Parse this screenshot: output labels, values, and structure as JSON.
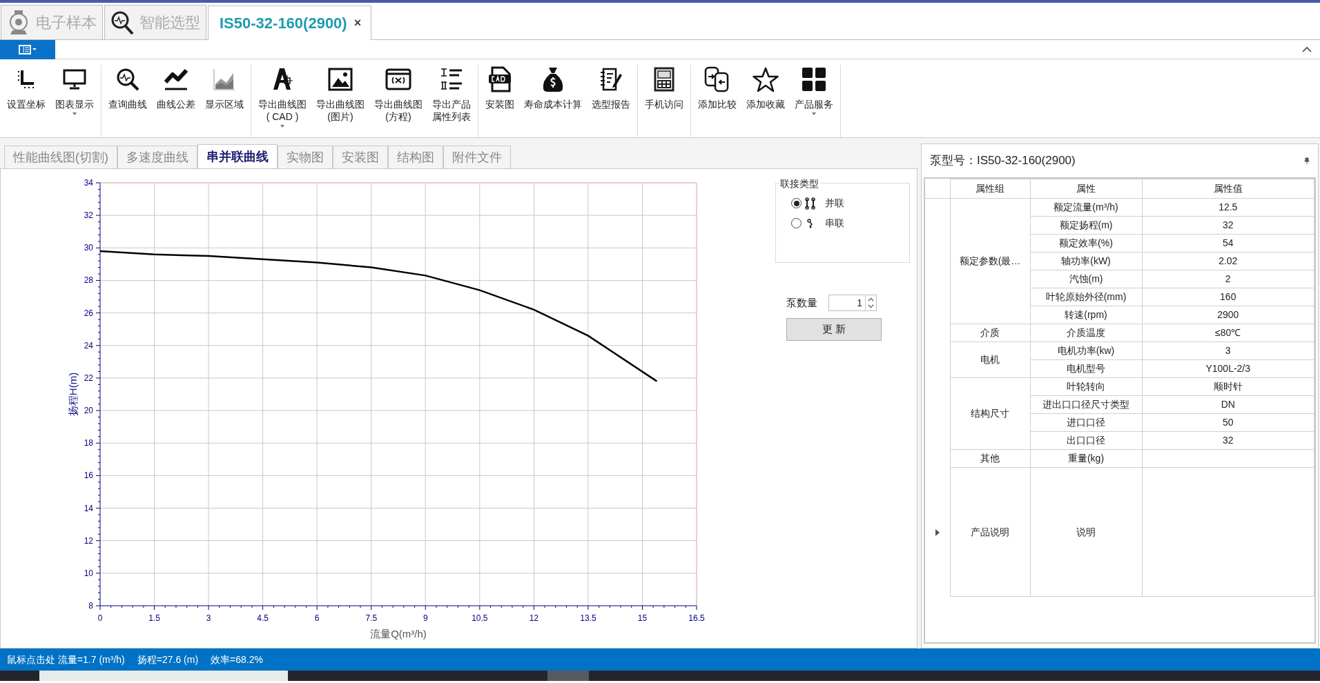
{
  "top_tabs": [
    {
      "label": "电子样本",
      "selected": false,
      "kind": "pump"
    },
    {
      "label": "智能选型",
      "selected": false,
      "kind": "search"
    },
    {
      "label": "IS50-32-160(2900)",
      "selected": true,
      "close": "×"
    }
  ],
  "toolbar_groups": [
    [
      {
        "lines": [
          "设置坐标"
        ],
        "kind": "axis",
        "dropdown": false
      },
      {
        "lines": [
          "图表显示"
        ],
        "kind": "monitor",
        "dropdown": true
      }
    ],
    [
      {
        "lines": [
          "查询曲线"
        ],
        "kind": "query",
        "dropdown": false
      },
      {
        "lines": [
          "曲线公差"
        ],
        "kind": "curve",
        "dropdown": false
      },
      {
        "lines": [
          "显示区域"
        ],
        "kind": "area",
        "dropdown": false
      }
    ],
    [
      {
        "lines": [
          "导出曲线图",
          "( CAD )"
        ],
        "kind": "cadpen",
        "dropdown": true
      },
      {
        "lines": [
          "导出曲线图",
          "(图片)"
        ],
        "kind": "image",
        "dropdown": false
      },
      {
        "lines": [
          "导出曲线图",
          "(方程)"
        ],
        "kind": "formula",
        "dropdown": false
      },
      {
        "lines": [
          "导出产品",
          "属性列表"
        ],
        "kind": "list",
        "dropdown": false
      }
    ],
    [
      {
        "lines": [
          "安装图"
        ],
        "kind": "cad",
        "dropdown": false
      },
      {
        "lines": [
          "寿命成本计算"
        ],
        "kind": "money",
        "dropdown": false
      },
      {
        "lines": [
          "选型报告"
        ],
        "kind": "report",
        "dropdown": false
      }
    ],
    [
      {
        "lines": [
          "手机访问"
        ],
        "kind": "calculator",
        "dropdown": false
      }
    ],
    [
      {
        "lines": [
          "添加比较"
        ],
        "kind": "compare",
        "dropdown": false
      },
      {
        "lines": [
          "添加收藏"
        ],
        "kind": "star",
        "dropdown": false
      },
      {
        "lines": [
          "产品服务"
        ],
        "kind": "grid",
        "dropdown": true
      }
    ]
  ],
  "sub_tabs": [
    {
      "label": "性能曲线图(切割)",
      "selected": false
    },
    {
      "label": "多速度曲线",
      "selected": false
    },
    {
      "label": "串并联曲线",
      "selected": true
    },
    {
      "label": "实物图",
      "selected": false
    },
    {
      "label": "安装图",
      "selected": false
    },
    {
      "label": "结构图",
      "selected": false
    },
    {
      "label": "附件文件",
      "selected": false
    }
  ],
  "chart_data": {
    "type": "line",
    "grid": true,
    "xlabel": "流量Q(m³/h)",
    "ylabel": "扬程H(m)",
    "x": [
      0,
      1.5,
      3,
      4.5,
      6,
      7.5,
      9,
      10.5,
      12,
      13.5,
      15.4
    ],
    "series": [
      {
        "color": "#000000",
        "values": [
          29.8,
          29.6,
          29.5,
          29.3,
          29.1,
          28.8,
          28.3,
          27.4,
          26.2,
          24.6,
          21.8
        ]
      }
    ],
    "xlim": [
      0,
      16.5
    ],
    "ylim": [
      8,
      34
    ],
    "xticks": [
      0,
      1.5,
      3,
      4.5,
      6,
      7.5,
      9,
      10.5,
      12,
      13.5,
      15,
      16.5
    ],
    "yticks": [
      8,
      10,
      12,
      14,
      16,
      18,
      20,
      22,
      24,
      26,
      28,
      30,
      32,
      34
    ]
  },
  "connection": {
    "title": "联接类型",
    "options": [
      {
        "label": "并联",
        "selected": true,
        "kind": "parallel"
      },
      {
        "label": "串联",
        "selected": false,
        "kind": "series"
      }
    ]
  },
  "pump_count": {
    "label": "泵数量",
    "value": "1"
  },
  "update_button": "更 新",
  "properties": {
    "title": "泵型号：IS50-32-160(2900)",
    "columns": [
      "属性组",
      "属性",
      "属性值"
    ],
    "groups": [
      {
        "name": "额定参数(最…",
        "current": false,
        "rows": [
          {
            "property": "额定流量(m³/h)",
            "value": "12.5"
          },
          {
            "property": "额定扬程(m)",
            "value": "32"
          },
          {
            "property": "额定效率(%)",
            "value": "54"
          },
          {
            "property": "轴功率(kW)",
            "value": "2.02"
          },
          {
            "property": "汽蚀(m)",
            "value": "2"
          },
          {
            "property": "叶轮原始外径(mm)",
            "value": "160"
          },
          {
            "property": "转速(rpm)",
            "value": "2900"
          }
        ]
      },
      {
        "name": "介质",
        "current": false,
        "rows": [
          {
            "property": "介质温度",
            "value": "≤80℃"
          }
        ]
      },
      {
        "name": "电机",
        "current": false,
        "rows": [
          {
            "property": "电机功率(kw)",
            "value": "3"
          },
          {
            "property": "电机型号",
            "value": "Y100L-2/3"
          }
        ]
      },
      {
        "name": "结构尺寸",
        "current": false,
        "rows": [
          {
            "property": "叶轮转向",
            "value": "顺时针"
          },
          {
            "property": "进出口口径尺寸类型",
            "value": "DN"
          },
          {
            "property": "进口口径",
            "value": "50"
          },
          {
            "property": "出口口径",
            "value": "32"
          }
        ]
      },
      {
        "name": "其他",
        "current": false,
        "rows": [
          {
            "property": "重量(kg)"
          }
        ]
      },
      {
        "name": "产品说明",
        "current": true,
        "rows": [
          {
            "property": "说明"
          }
        ]
      }
    ]
  },
  "status_bar": [
    "鼠标点击处 流量=1.7 (m³/h)",
    "扬程=27.6 (m)",
    "效率=68.2%"
  ]
}
